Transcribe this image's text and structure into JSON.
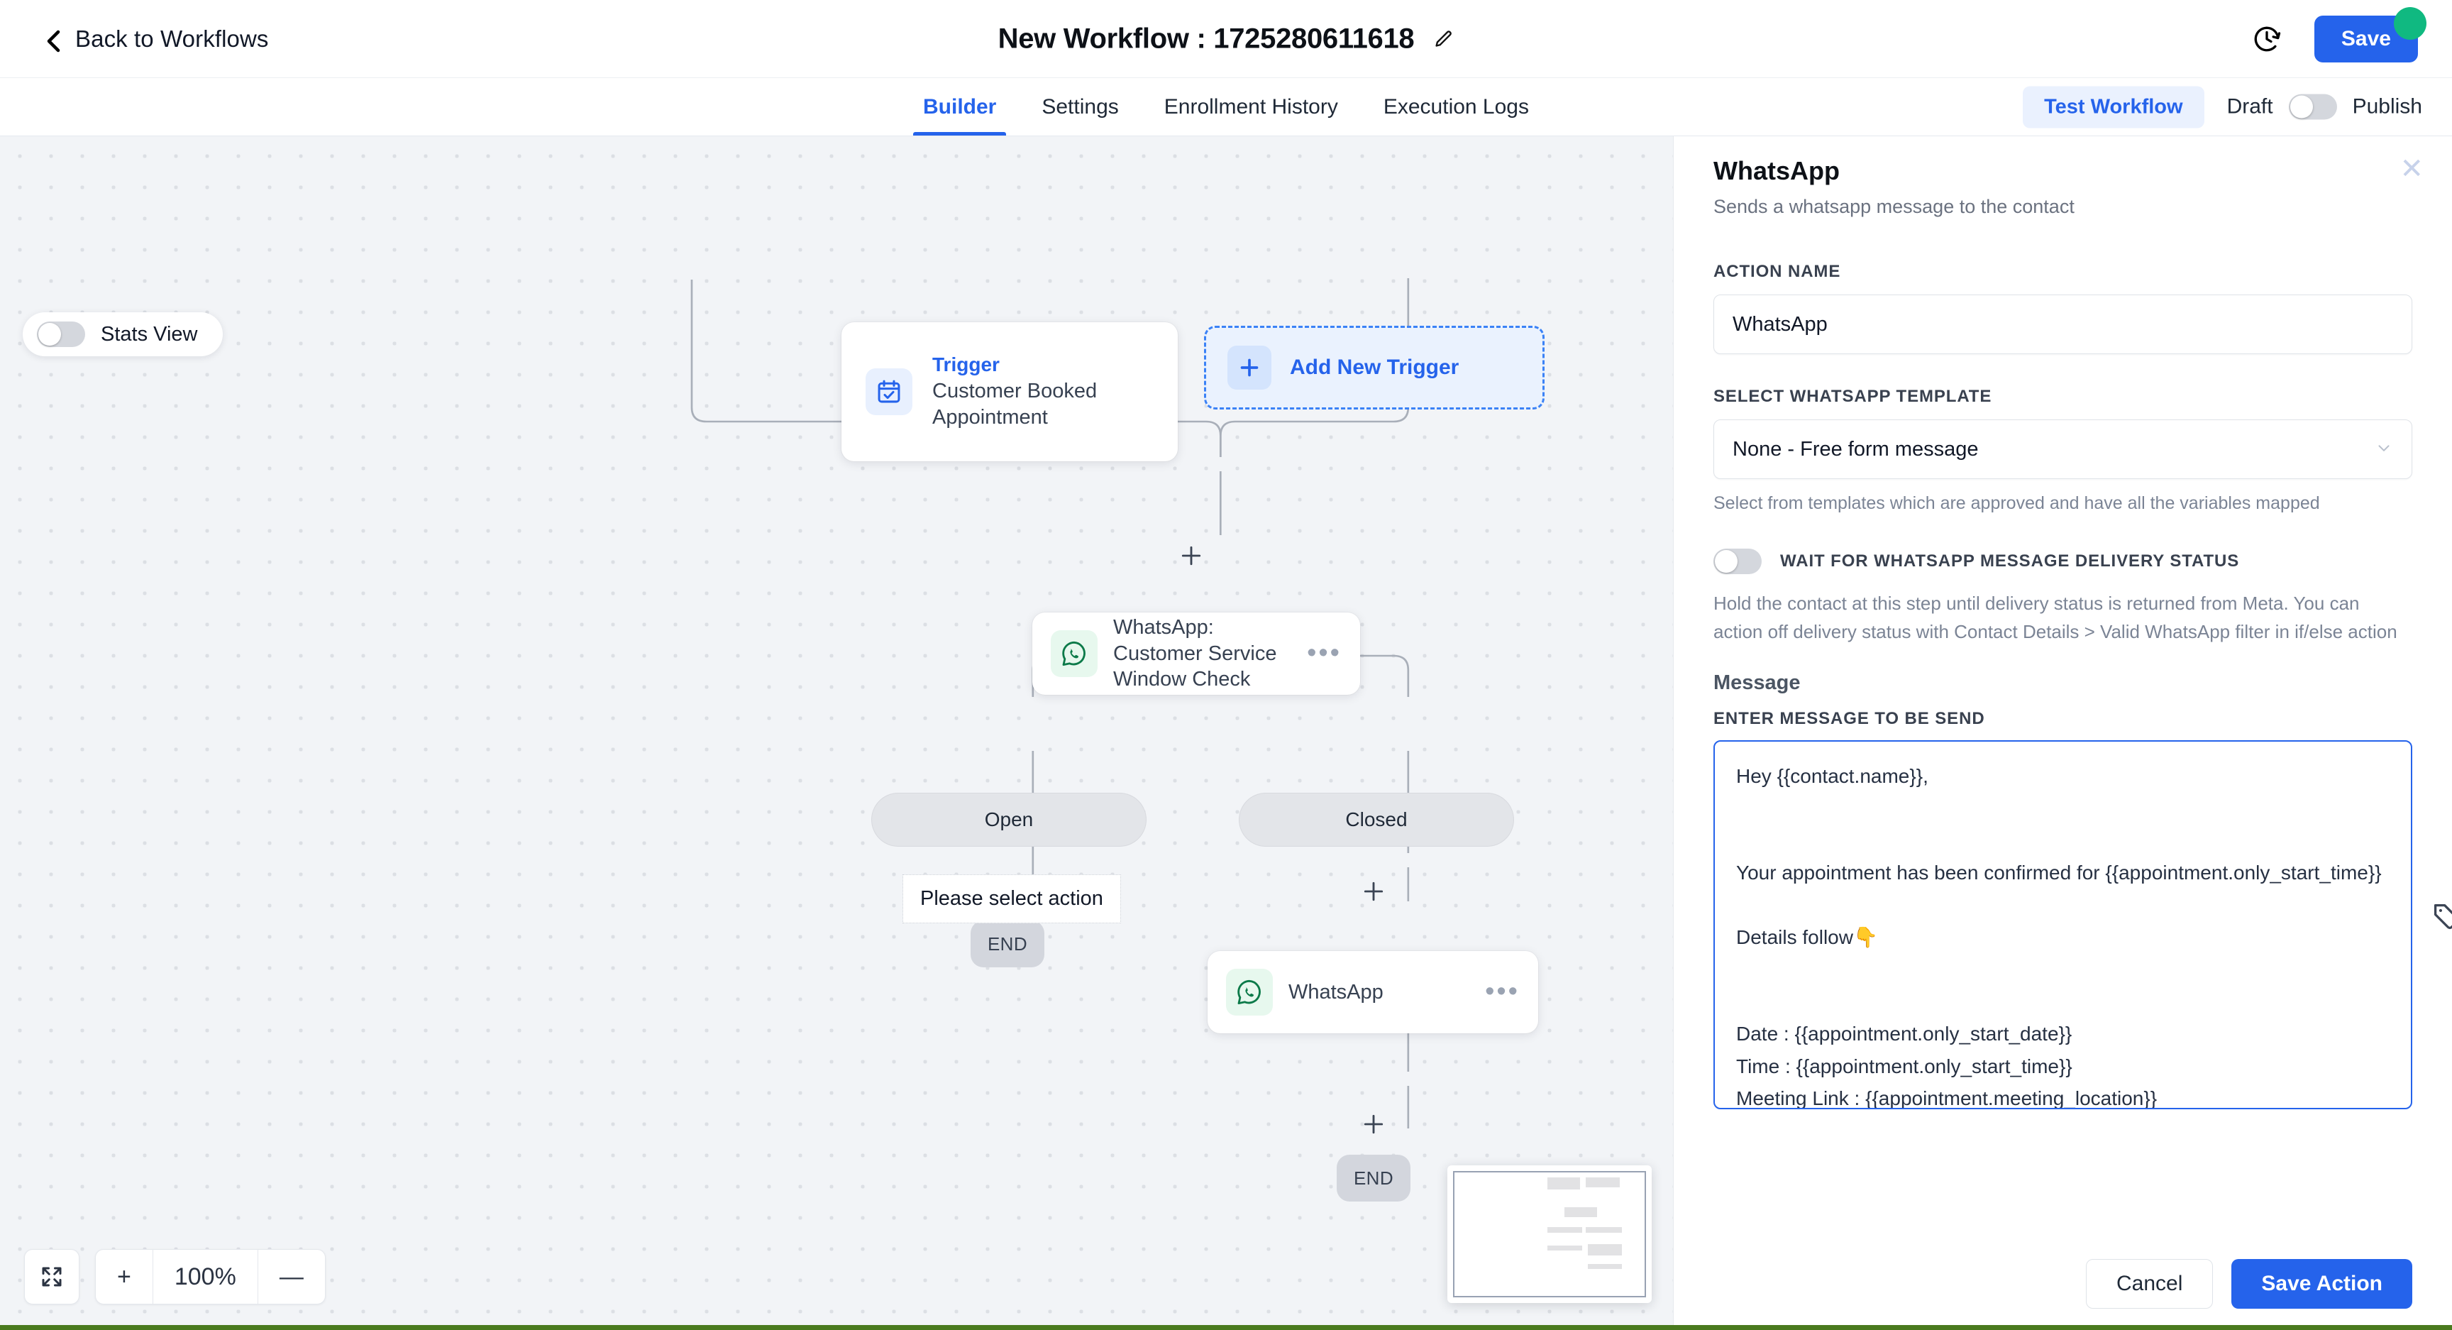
{
  "topbar": {
    "back_label": "Back to Workflows",
    "back_icon": "chevron-left-icon",
    "workflow_title": "New Workflow : 1725280611618",
    "edit_icon": "pencil-icon",
    "history_icon": "history-clock-icon",
    "save_label": "Save",
    "save_badge_color": "#10b981",
    "accent_color": "#2563eb"
  },
  "tabs": [
    {
      "label": "Builder",
      "active": true
    },
    {
      "label": "Settings",
      "active": false
    },
    {
      "label": "Enrollment History",
      "active": false
    },
    {
      "label": "Execution Logs",
      "active": false
    }
  ],
  "tabbar_right": {
    "test_workflow_label": "Test Workflow",
    "draft_label": "Draft",
    "publish_label": "Publish",
    "publish_toggle_on": false
  },
  "canvas": {
    "stats_view_label": "Stats View",
    "stats_view_on": false,
    "trigger_node": {
      "kicker": "Trigger",
      "title": "Customer Booked Appointment",
      "icon": "calendar-check-icon"
    },
    "add_trigger": {
      "label": "Add New Trigger",
      "icon": "plus-icon"
    },
    "condition_node": {
      "title": "WhatsApp: Customer Service Window Check",
      "icon": "whatsapp-icon",
      "menu_icon": "ellipsis-icon"
    },
    "branches": [
      {
        "label": "Open"
      },
      {
        "label": "Closed"
      }
    ],
    "tooltip": "Please select action",
    "action_node": {
      "title": "WhatsApp",
      "icon": "whatsapp-icon",
      "menu_icon": "ellipsis-icon"
    },
    "end_labels": [
      "END",
      "END"
    ],
    "zoom": {
      "fit_icon": "fit-screen-icon",
      "zoom_in_label": "+",
      "level": "100%",
      "zoom_out_label": "—"
    },
    "minimap_name": "minimap"
  },
  "panel": {
    "title": "WhatsApp",
    "subtitle": "Sends a whatsapp message to the contact",
    "close_icon": "close-icon",
    "action_name_label": "ACTION NAME",
    "action_name_value": "WhatsApp",
    "action_name_placeholder": "Action name",
    "template_label": "SELECT WHATSAPP TEMPLATE",
    "template_value": "None - Free form message",
    "template_helper": "Select from templates which are approved and have all the variables mapped",
    "wait_toggle_label": "WAIT FOR WHATSAPP MESSAGE DELIVERY STATUS",
    "wait_toggle_on": false,
    "wait_helper": "Hold the contact at this step until delivery status is returned from Meta. You can action off delivery status with Contact Details > Valid WhatsApp filter in if/else action",
    "message_heading": "Message",
    "message_label": "ENTER MESSAGE TO BE SEND",
    "message_value": "Hey {{contact.name}},\n\n\nYour appointment has been confirmed for {{appointment.only_start_time}}\n\nDetails follow👇\n\n\nDate : {{appointment.only_start_date}}\nTime : {{appointment.only_start_time}}\nMeeting Link : {{appointment.meeting_location}}",
    "message_placeholder": "Enter message to be send",
    "tag_icon": "tag-icon",
    "cancel_label": "Cancel",
    "save_action_label": "Save Action"
  }
}
